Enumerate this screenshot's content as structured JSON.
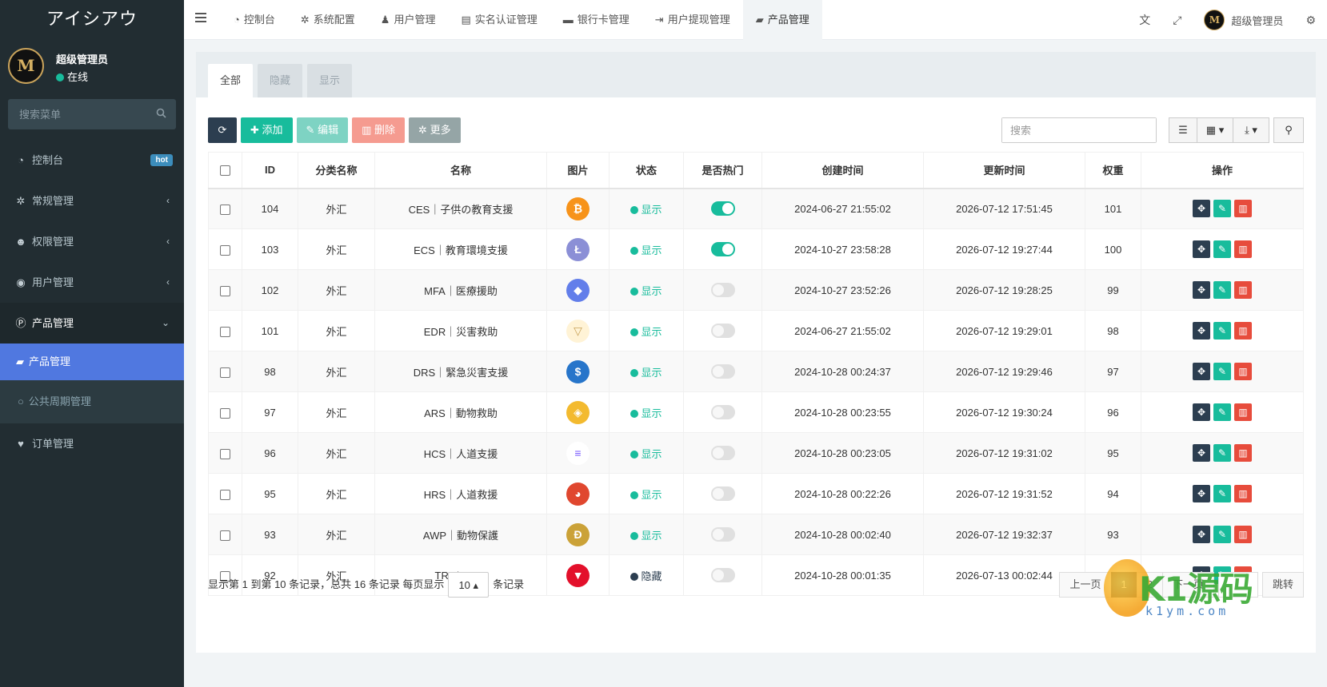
{
  "sidebar": {
    "brand": "アイシアウ",
    "avatar_text": "M",
    "user_name": "超级管理员",
    "user_status": "在线",
    "search_placeholder": "搜索菜单",
    "items": [
      {
        "label": "控制台",
        "icon": "dashboard-icon",
        "badge": "hot"
      },
      {
        "label": "常规管理",
        "icon": "cogs-icon"
      },
      {
        "label": "权限管理",
        "icon": "group-icon"
      },
      {
        "label": "用户管理",
        "icon": "user-circle-icon"
      },
      {
        "label": "产品管理",
        "icon": "product-p-icon"
      }
    ],
    "submenu": [
      {
        "label": "产品管理",
        "icon": "shopping-bag-icon"
      },
      {
        "label": "公共周期管理",
        "icon": "circle-o-icon"
      }
    ],
    "last_item": {
      "label": "订单管理",
      "icon": "heartbeat-icon"
    }
  },
  "header": {
    "tabs": [
      {
        "label": "控制台",
        "icon": "dashboard-icon"
      },
      {
        "label": "系统配置",
        "icon": "cog-icon"
      },
      {
        "label": "用户管理",
        "icon": "user-icon"
      },
      {
        "label": "实名认证管理",
        "icon": "id-card-icon"
      },
      {
        "label": "银行卡管理",
        "icon": "credit-card-icon"
      },
      {
        "label": "用户提现管理",
        "icon": "sign-out-icon"
      },
      {
        "label": "产品管理",
        "icon": "shopping-bag-icon"
      }
    ],
    "user_name": "超级管理员"
  },
  "panel": {
    "tabs": [
      "全部",
      "隐藏",
      "显示"
    ],
    "toolbar": {
      "add": "添加",
      "edit": "编辑",
      "delete": "删除",
      "more": "更多"
    },
    "search_placeholder": "搜索",
    "columns": [
      "ID",
      "分类名称",
      "名称",
      "图片",
      "状态",
      "是否热门",
      "创建时间",
      "更新时间",
      "权重",
      "操作"
    ],
    "rows": [
      {
        "id": "104",
        "category": "外汇",
        "name": "CES｜子供の教育支援",
        "coin": "bitcoin",
        "status": "显示",
        "hot": true,
        "created": "2024-06-27 21:55:02",
        "updated": "2026-07-12 17:51:45",
        "weight": "101"
      },
      {
        "id": "103",
        "category": "外汇",
        "name": "ECS｜教育環境支援",
        "coin": "litecoin",
        "status": "显示",
        "hot": true,
        "created": "2024-10-27 23:58:28",
        "updated": "2026-07-12 19:27:44",
        "weight": "100"
      },
      {
        "id": "102",
        "category": "外汇",
        "name": "MFA｜医療援助",
        "coin": "ethereum",
        "status": "显示",
        "hot": false,
        "created": "2024-10-27 23:52:26",
        "updated": "2026-07-12 19:28:25",
        "weight": "99"
      },
      {
        "id": "101",
        "category": "外汇",
        "name": "EDR｜災害救助",
        "coin": "tether-gold",
        "status": "显示",
        "hot": false,
        "created": "2024-06-27 21:55:02",
        "updated": "2026-07-12 19:29:01",
        "weight": "98"
      },
      {
        "id": "98",
        "category": "外汇",
        "name": "DRS｜緊急災害支援",
        "coin": "usd-coin",
        "status": "显示",
        "hot": false,
        "created": "2024-10-28 00:24:37",
        "updated": "2026-07-12 19:29:46",
        "weight": "97"
      },
      {
        "id": "97",
        "category": "外汇",
        "name": "ARS｜動物救助",
        "coin": "binance",
        "status": "显示",
        "hot": false,
        "created": "2024-10-28 00:23:55",
        "updated": "2026-07-12 19:30:24",
        "weight": "96"
      },
      {
        "id": "96",
        "category": "外汇",
        "name": "HCS｜人道支援",
        "coin": "solana",
        "status": "显示",
        "hot": false,
        "created": "2024-10-28 00:23:05",
        "updated": "2026-07-12 19:31:02",
        "weight": "95"
      },
      {
        "id": "95",
        "category": "外汇",
        "name": "HRS｜人道救援",
        "coin": "shiba",
        "status": "显示",
        "hot": false,
        "created": "2024-10-28 00:22:26",
        "updated": "2026-07-12 19:31:52",
        "weight": "94"
      },
      {
        "id": "93",
        "category": "外汇",
        "name": "AWP｜動物保護",
        "coin": "dogecoin",
        "status": "显示",
        "hot": false,
        "created": "2024-10-28 00:02:40",
        "updated": "2026-07-12 19:32:37",
        "weight": "93"
      },
      {
        "id": "92",
        "category": "外汇",
        "name": "TRX/USDT",
        "coin": "tron",
        "status": "隐藏",
        "hot": false,
        "created": "2024-10-28 00:01:35",
        "updated": "2026-07-13 00:02:44",
        "weight": "92"
      }
    ],
    "footer": {
      "info_before": "显示第 1 到第 10 条记录，总共 16 条记录 每页显示",
      "page_size": "10",
      "info_after": "条记录"
    },
    "pagination": {
      "prev": "上一页",
      "pages": [
        "1",
        "2"
      ],
      "next": "下一页",
      "jump": "跳转"
    }
  },
  "colors": {
    "sidebar_bg": "#222d32",
    "accent": "#18bc9c",
    "primary": "#2c3e50",
    "danger": "#e74c3c",
    "active_sub": "#5078e0",
    "status_show": "#18bc9c",
    "status_hide": "#2c3e50"
  },
  "coin_styles": {
    "bitcoin": {
      "bg": "#f7931a",
      "glyph": "₿"
    },
    "litecoin": {
      "bg": "#8b8fd6",
      "glyph": "Ł"
    },
    "ethereum": {
      "bg": "#627eea",
      "glyph": "◆"
    },
    "tether-gold": {
      "bg": "#fff3d6",
      "glyph": "▽"
    },
    "usd-coin": {
      "bg": "#2775ca",
      "glyph": "$"
    },
    "binance": {
      "bg": "#f3ba2f",
      "glyph": "◈"
    },
    "solana": {
      "bg": "#ffffff",
      "glyph": "≡"
    },
    "shiba": {
      "bg": "#e0472f",
      "glyph": "◕"
    },
    "dogecoin": {
      "bg": "#cba238",
      "glyph": "Ð"
    },
    "tron": {
      "bg": "#e3102b",
      "glyph": "▼"
    }
  },
  "watermark": {
    "text": "K1源码",
    "sub": "k1ym.com"
  }
}
